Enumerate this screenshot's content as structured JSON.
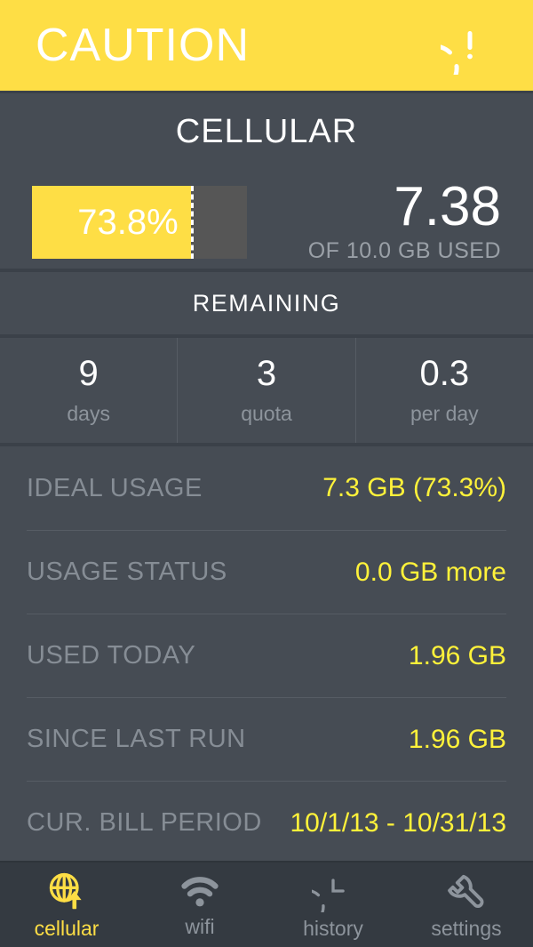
{
  "header": {
    "title": "CAUTION",
    "icon": "exclamation-circle-icon",
    "background_color": "#fede45"
  },
  "cellular": {
    "title": "CELLULAR",
    "progress": {
      "percent_label": "73.8%",
      "percent_value": 73.8,
      "fill_color": "#fede45",
      "track_color": "#565656"
    },
    "amount_used": "7.38",
    "amount_caption": "OF 10.0 GB USED"
  },
  "remaining": {
    "header": "REMAINING",
    "stats": [
      {
        "value": "9",
        "label": "days"
      },
      {
        "value": "3",
        "label": "quota"
      },
      {
        "value": "0.3",
        "label": "per day"
      }
    ]
  },
  "details": {
    "value_color": "#fff23a",
    "rows": [
      {
        "label": "IDEAL USAGE",
        "value": "7.3 GB (73.3%)"
      },
      {
        "label": "USAGE STATUS",
        "value": "0.0 GB more"
      },
      {
        "label": "USED TODAY",
        "value": "1.96 GB"
      },
      {
        "label": "SINCE LAST RUN",
        "value": "1.96 GB"
      },
      {
        "label": "CUR. BILL PERIOD",
        "value": "10/1/13 - 10/31/13"
      }
    ]
  },
  "tabbar": {
    "active_color": "#fede45",
    "inactive_color": "#8d949c",
    "tabs": [
      {
        "label": "cellular",
        "icon": "globe-upload-icon",
        "active": true
      },
      {
        "label": "wifi",
        "icon": "wifi-icon",
        "active": false
      },
      {
        "label": "history",
        "icon": "clock-icon",
        "active": false
      },
      {
        "label": "settings",
        "icon": "wrench-icon",
        "active": false
      }
    ]
  }
}
